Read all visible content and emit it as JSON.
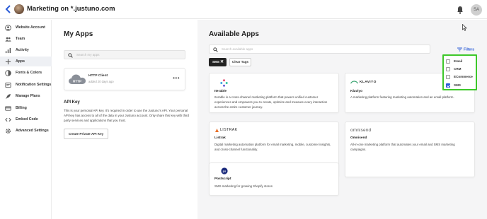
{
  "header": {
    "back_icon": "chevron-left-icon",
    "title": "Marketing on *.justuno.com",
    "bell_icon": "bell-icon",
    "user_initials": "SA"
  },
  "sidebar": {
    "items": [
      {
        "label": "Website Account",
        "icon": "account-icon"
      },
      {
        "label": "Team",
        "icon": "team-icon"
      },
      {
        "label": "Activity",
        "icon": "activity-icon"
      },
      {
        "label": "Apps",
        "icon": "apps-icon",
        "active": true
      },
      {
        "label": "Fonts & Colors",
        "icon": "palette-icon"
      },
      {
        "label": "Notification Settings",
        "icon": "notification-icon"
      },
      {
        "label": "Manage Plans",
        "icon": "rocket-icon"
      },
      {
        "label": "Billing",
        "icon": "billing-icon"
      },
      {
        "label": "Embed Code",
        "icon": "code-icon"
      },
      {
        "label": "Advanced Settings",
        "icon": "gear-icon"
      }
    ]
  },
  "my_apps": {
    "title": "My Apps",
    "search_placeholder": "Search my apps",
    "client": {
      "logo_text": "HTTP",
      "name": "HTTP Client",
      "date": "added 20 days ago",
      "menu": "•••"
    },
    "api_key": {
      "title": "API Key",
      "text": "This is your personal API key. It's required in order to use the Justuno's API. Your personal API key has access to all of the data in your Justuno account. Only share this key with third party services and applications that you trust.",
      "button": "Create Private API Key"
    }
  },
  "available_apps": {
    "title": "Available Apps",
    "search_placeholder": "Search available apps",
    "tag": "SMS",
    "clear_button": "Clear Tags",
    "filters_label": "Filters",
    "filter_options": [
      {
        "label": "Email",
        "checked": false
      },
      {
        "label": "CRM",
        "checked": false
      },
      {
        "label": "ECommerce",
        "checked": false
      },
      {
        "label": "SMS",
        "checked": true
      }
    ],
    "apps": [
      {
        "logo": "iterable-logo",
        "name": "Iterable",
        "description": "Iterable is a cross-channel marketing platform that powers unified customer experiences and empowers you to create, optimize and measure every interaction across the entire customer journey."
      },
      {
        "logo": "klaviyo-logo",
        "logo_text": "KLAVIYO",
        "name": "Klaviyo",
        "description": "A marketing platform featuring marketing automation and an email platform."
      },
      {
        "logo": "listrak-logo",
        "logo_text": "LISTRAK",
        "name": "Listrak",
        "description": "Digital marketing automation platform for email marketing, mobile, customer insights, and cross-channel functionality."
      },
      {
        "logo": "omnisend-logo",
        "logo_text": "omnisend",
        "name": "Omnisend",
        "description": "All-in-one marketing platform that automates your email and SMS marketing campaigns."
      },
      {
        "logo": "postscript-logo",
        "logo_text": "ps",
        "name": "Postscript",
        "description": "SMS marketing for growing Shopify stores"
      }
    ]
  }
}
